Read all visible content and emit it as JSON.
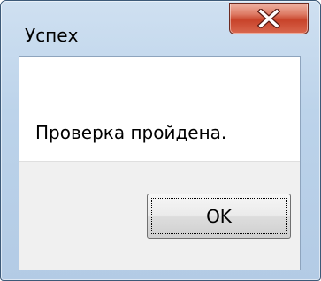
{
  "window": {
    "title": "Успех",
    "close_icon": "close-icon"
  },
  "dialog": {
    "message": "Проверка пройдена.",
    "ok_label": "OK"
  },
  "colors": {
    "frame": "#bcd3ea",
    "close_button": "#c8432a",
    "footer": "#f0f0f0"
  }
}
